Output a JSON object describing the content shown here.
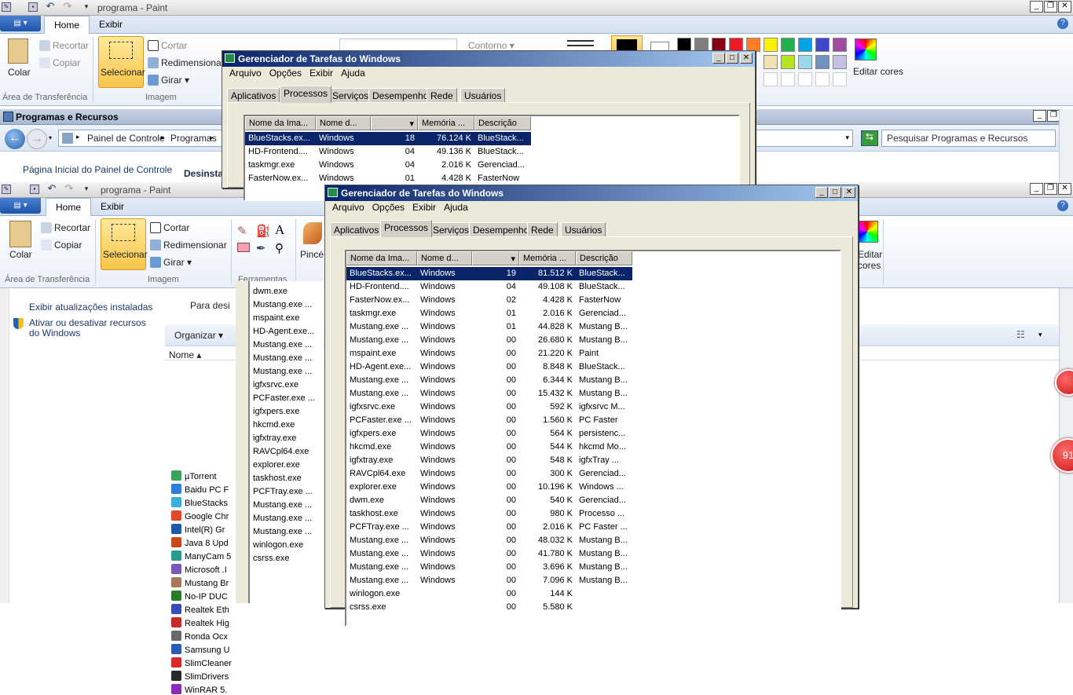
{
  "paint_back": {
    "title": "programa - Paint",
    "tabs": [
      "Home",
      "Exibir"
    ],
    "clipboard": {
      "paste": "Colar",
      "cut": "Recortar",
      "copy": "Copiar",
      "group": "Área de Transferência"
    },
    "image": {
      "select": "Selecionar",
      "crop": "Cortar",
      "resize": "Redimensionar",
      "rotate": "Girar",
      "group": "Imagem"
    },
    "shapes": {
      "outline": "Contorno"
    },
    "colors": {
      "edit": "Editar cores"
    }
  },
  "control_panel": {
    "title": "Programas e Recursos",
    "breadcrumb": [
      "Painel de Controle",
      "Programas"
    ],
    "search_placeholder": "Pesquisar Programas e Recursos",
    "home_link": "Página Inicial do Painel de Controle",
    "uninstall_heading": "Desinsta",
    "side_links": [
      "Exibir atualizações instaladas",
      "Ativar ou desativar recursos do Windows"
    ],
    "intro_text": "Para desi",
    "organize": "Organizar",
    "name_column": "Nome",
    "programs": [
      "µTorrent",
      "Baidu PC F",
      "BlueStacks",
      "Google Chr",
      "Intel(R) Gr",
      "Java 8 Upd",
      "ManyCam 5",
      "Microsoft .I",
      "Mustang Br",
      "No-IP DUC",
      "Realtek Eth",
      "Realtek Hig",
      "Ronda Ocx",
      "Samsung U",
      "SlimCleaner",
      "SlimDrivers",
      "WinRAR 5."
    ]
  },
  "paint_front": {
    "title": "programa - Paint",
    "tabs": [
      "Home",
      "Exibir"
    ],
    "clipboard": {
      "paste": "Colar",
      "cut": "Recortar",
      "copy": "Copiar",
      "group": "Área de Transferência"
    },
    "image": {
      "select": "Selecionar",
      "crop": "Cortar",
      "resize": "Redimensionar",
      "rotate": "Girar",
      "group": "Imagem"
    },
    "tools": {
      "group": "Ferramentas",
      "brush": "Pincé"
    },
    "colors": {
      "edit_1": "Editar",
      "edit_2": "cores"
    }
  },
  "taskmgr_back": {
    "title": "Gerenciador de Tarefas do Windows",
    "menu": [
      "Arquivo",
      "Opções",
      "Exibir",
      "Ajuda"
    ],
    "tabs": [
      "Aplicativos",
      "Processos",
      "Serviços",
      "Desempenho",
      "Rede",
      "Usuários"
    ],
    "columns": [
      "Nome da Ima...",
      "Nome d...",
      "",
      "Memória ...",
      "Descrição"
    ],
    "rows": [
      [
        "BlueStacks.ex...",
        "Windows",
        "18",
        "76.124 K",
        "BlueStack..."
      ],
      [
        "HD-Frontend....",
        "Windows",
        "04",
        "49.136 K",
        "BlueStack..."
      ],
      [
        "taskmgr.exe",
        "Windows",
        "04",
        "2.016 K",
        "Gerenciad..."
      ],
      [
        "FasterNow.ex...",
        "Windows",
        "01",
        "4.428 K",
        "FasterNow"
      ]
    ],
    "hidden_names": [
      "FasterNow....",
      "dwm.exe",
      "Mustang.exe ...",
      "mspaint.exe",
      "HD-Agent.exe...",
      "Mustang.exe ...",
      "Mustang.exe ...",
      "Mustang.exe ...",
      "igfxsrvc.exe",
      "PCFaster.exe ...",
      "igfxpers.exe",
      "hkcmd.exe",
      "igfxtray.exe",
      "RAVCpl64.exe",
      "explorer.exe",
      "taskhost.exe",
      "PCFTray.exe ...",
      "Mustang.exe ...",
      "Mustang.exe ...",
      "Mustang.exe ...",
      "winlogon.exe",
      "csrss.exe"
    ]
  },
  "taskmgr_front": {
    "title": "Gerenciador de Tarefas do Windows",
    "menu": [
      "Arquivo",
      "Opções",
      "Exibir",
      "Ajuda"
    ],
    "tabs": [
      "Aplicativos",
      "Processos",
      "Serviços",
      "Desempenho",
      "Rede",
      "Usuários"
    ],
    "columns": [
      "Nome da Ima...",
      "Nome d...",
      "",
      "Memória ...",
      "Descrição"
    ],
    "rows": [
      [
        "BlueStacks.ex...",
        "Windows",
        "19",
        "81.512 K",
        "BlueStack..."
      ],
      [
        "HD-Frontend....",
        "Windows",
        "04",
        "49.108 K",
        "BlueStack..."
      ],
      [
        "FasterNow.ex...",
        "Windows",
        "02",
        "4.428 K",
        "FasterNow"
      ],
      [
        "taskmgr.exe",
        "Windows",
        "01",
        "2.016 K",
        "Gerenciad..."
      ],
      [
        "Mustang.exe ...",
        "Windows",
        "01",
        "44.828 K",
        "Mustang B..."
      ],
      [
        "Mustang.exe ...",
        "Windows",
        "00",
        "26.680 K",
        "Mustang B..."
      ],
      [
        "mspaint.exe",
        "Windows",
        "00",
        "21.220 K",
        "Paint"
      ],
      [
        "HD-Agent.exe...",
        "Windows",
        "00",
        "8.848 K",
        "BlueStack..."
      ],
      [
        "Mustang.exe ...",
        "Windows",
        "00",
        "6.344 K",
        "Mustang B..."
      ],
      [
        "Mustang.exe ...",
        "Windows",
        "00",
        "15.432 K",
        "Mustang B..."
      ],
      [
        "igfxsrvc.exe",
        "Windows",
        "00",
        "592 K",
        "igfxsrvc M..."
      ],
      [
        "PCFaster.exe ...",
        "Windows",
        "00",
        "1.560 K",
        "PC Faster"
      ],
      [
        "igfxpers.exe",
        "Windows",
        "00",
        "564 K",
        "persistenc..."
      ],
      [
        "hkcmd.exe",
        "Windows",
        "00",
        "544 K",
        "hkcmd Mo..."
      ],
      [
        "igfxtray.exe",
        "Windows",
        "00",
        "548 K",
        "igfxTray ..."
      ],
      [
        "RAVCpl64.exe",
        "Windows",
        "00",
        "300 K",
        "Gerenciad..."
      ],
      [
        "explorer.exe",
        "Windows",
        "00",
        "10.196 K",
        "Windows ..."
      ],
      [
        "dwm.exe",
        "Windows",
        "00",
        "540 K",
        "Gerenciad..."
      ],
      [
        "taskhost.exe",
        "Windows",
        "00",
        "980 K",
        "Processo ..."
      ],
      [
        "PCFTray.exe ...",
        "Windows",
        "00",
        "2.016 K",
        "PC Faster ..."
      ],
      [
        "Mustang.exe ...",
        "Windows",
        "00",
        "48.032 K",
        "Mustang B..."
      ],
      [
        "Mustang.exe ...",
        "Windows",
        "00",
        "41.780 K",
        "Mustang B..."
      ],
      [
        "Mustang.exe ...",
        "Windows",
        "00",
        "3.696 K",
        "Mustang B..."
      ],
      [
        "Mustang.exe ...",
        "Windows",
        "00",
        "7.096 K",
        "Mustang B..."
      ],
      [
        "winlogon.exe",
        "",
        "00",
        "144 K",
        ""
      ],
      [
        "csrss.exe",
        "",
        "00",
        "5.580 K",
        ""
      ]
    ]
  },
  "badge": {
    "count": "91"
  }
}
